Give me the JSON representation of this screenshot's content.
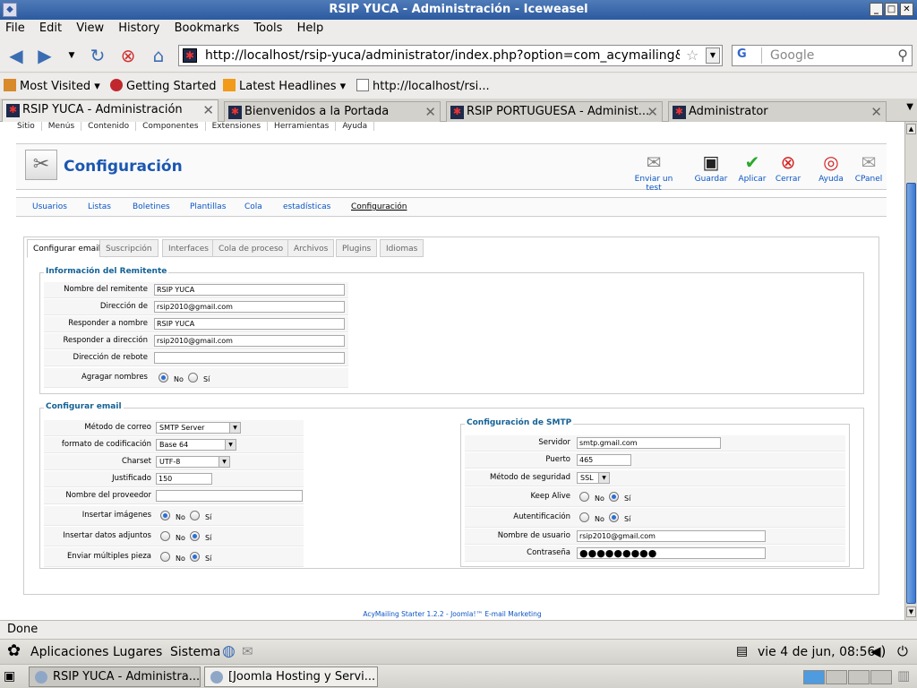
{
  "window": {
    "title": "RSIP YUCA - Administración - Iceweasel",
    "min_glyph": "_",
    "max_glyph": "□",
    "close_glyph": "✕"
  },
  "menubar": [
    "File",
    "Edit",
    "View",
    "History",
    "Bookmarks",
    "Tools",
    "Help"
  ],
  "navbar": {
    "url": "http://localhost/rsip-yuca/administrator/index.php?option=com_acymailing&ctrl=conf",
    "search_placeholder": "Google",
    "search_engine_glyph": "G"
  },
  "bookmarks": [
    "Most Visited",
    "Getting Started",
    "Latest Headlines",
    "http://localhost/rsi..."
  ],
  "tabs": [
    {
      "label": "RSIP YUCA - Administración",
      "active": true
    },
    {
      "label": "Bienvenidos a la Portada",
      "active": false
    },
    {
      "label": "RSIP PORTUGUESA - Administ...",
      "active": false
    },
    {
      "label": "Administrator",
      "active": false
    }
  ],
  "joomla_menu": [
    "Sitio",
    "Menús",
    "Contenido",
    "Componentes",
    "Extensiones",
    "Herramientas",
    "Ayuda"
  ],
  "page": {
    "title": "Configuración",
    "toolbar": {
      "test": "Enviar un test",
      "save": "Guardar",
      "apply": "Aplicar",
      "cancel": "Cerrar",
      "help": "Ayuda",
      "cpanel": "CPanel"
    },
    "subnav": [
      "Usuarios",
      "Listas",
      "Boletines",
      "Plantillas",
      "Cola",
      "estadísticas",
      "Configuración"
    ],
    "tabs": [
      "Configurar email",
      "Suscripción",
      "Interfaces",
      "Cola de proceso",
      "Archivos",
      "Plugins",
      "Idiomas"
    ]
  },
  "sender": {
    "legend": "Información del Remitente",
    "from_name_label": "Nombre del remitente",
    "from_name": "RSIP YUCA",
    "from_email_label": "Dirección de",
    "from_email": "rsip2010@gmail.com",
    "reply_name_label": "Responder a nombre",
    "reply_name": "RSIP YUCA",
    "reply_email_label": "Responder a dirección",
    "reply_email": "rsip2010@gmail.com",
    "bounce_label": "Dirección de rebote",
    "bounce": "",
    "add_names_label": "Agragar nombres",
    "no": "No",
    "yes": "Sí"
  },
  "email_config": {
    "legend": "Configurar email",
    "method_label": "Método de correo",
    "method": "SMTP Server",
    "encoding_label": "formato de codificación",
    "encoding": "Base 64",
    "charset_label": "Charset",
    "charset": "UTF-8",
    "wordwrap_label": "Justificado",
    "wordwrap": "150",
    "hostname_label": "Nombre del proveedor",
    "hostname": "",
    "embed_images_label": "Insertar imágenes",
    "embed_attach_label": "Insertar datos adjuntos",
    "multiple_part_label": "Enviar múltiples pieza",
    "no": "No",
    "yes": "Sí"
  },
  "smtp": {
    "legend": "Configuración de SMTP",
    "server_label": "Servidor",
    "server": "smtp.gmail.com",
    "port_label": "Puerto",
    "port": "465",
    "security_label": "Método de seguridad",
    "security": "SSL",
    "keepalive_label": "Keep Alive",
    "auth_label": "Autentificación",
    "username_label": "Nombre de usuario",
    "username": "rsip2010@gmail.com",
    "password_label": "Contraseña",
    "password_masked": "●●●●●●●●●",
    "no": "No",
    "yes": "Sí"
  },
  "footer_link": "AcyMailing Starter 1.2.2 - Joomla!™ E-mail Marketing",
  "statusbar": "Done",
  "gnome_panel": {
    "apps": "Aplicaciones",
    "places": "Lugares",
    "system": "Sistema",
    "clock": "vie  4 de jun, 08:56"
  },
  "taskbar": [
    "RSIP YUCA - Administra...",
    "[Joomla Hosting y Servi..."
  ]
}
